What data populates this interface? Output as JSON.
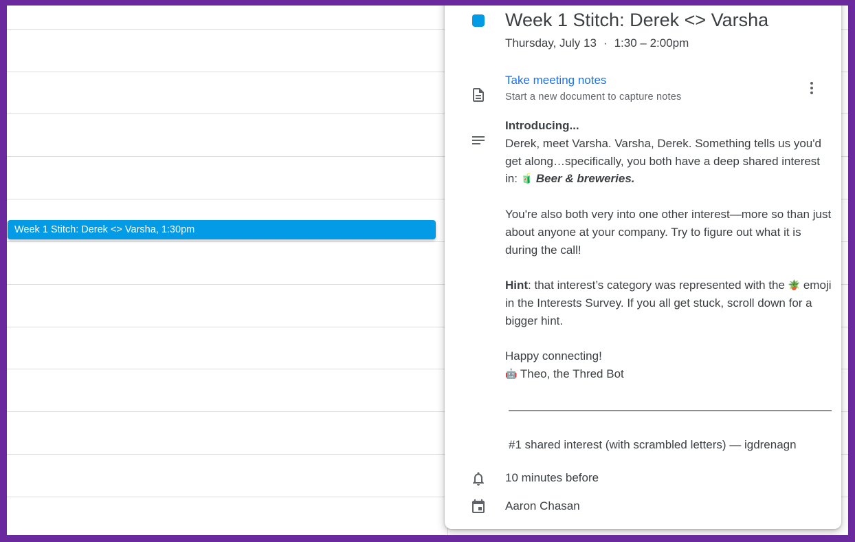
{
  "calendar": {
    "event_chip": {
      "title": "Week 1 Stitch: Derek <> Varsha,",
      "time": "1:30pm",
      "color": "#039be5"
    }
  },
  "popup": {
    "title": "Week 1 Stitch: Derek <> Varsha",
    "date": "Thursday, July 13",
    "separator": "·",
    "time_range": "1:30 – 2:00pm",
    "notes": {
      "link": "Take meeting notes",
      "subtitle": "Start a new document to capture notes"
    },
    "description": {
      "heading": "Introducing...",
      "para1_text": "Derek, meet Varsha. Varsha, Derek. Something tells us you'd get along…specifically, you both have a deep shared interest in:",
      "para1_emoji": "🧃",
      "para1_interest": "Beer & breweries.",
      "para2": "You're also both very into one other interest—more so than just about anyone at your company. Try to figure out what it is during the call!",
      "hint_label": "Hint",
      "hint_text_a": ": that interest’s category was represented with the",
      "hint_emoji": "🪴",
      "hint_text_b": "emoji in the Interests Survey. If you all get stuck, scroll down for a bigger hint.",
      "closing": "Happy connecting!",
      "signature_emoji": "🤖",
      "signature": "Theo, the Thred Bot",
      "divider": "———————————————————————————————",
      "scrambled": "#1 shared interest (with scrambled letters) — igdrenagn"
    },
    "reminder": "10 minutes before",
    "organizer": "Aaron Chasan"
  },
  "colors": {
    "frame": "#6a2a9e",
    "accent": "#039be5",
    "link": "#1a73e8"
  },
  "icons": [
    "document-icon",
    "more-vert-icon",
    "description-icon",
    "bell-icon",
    "calendar-icon"
  ]
}
